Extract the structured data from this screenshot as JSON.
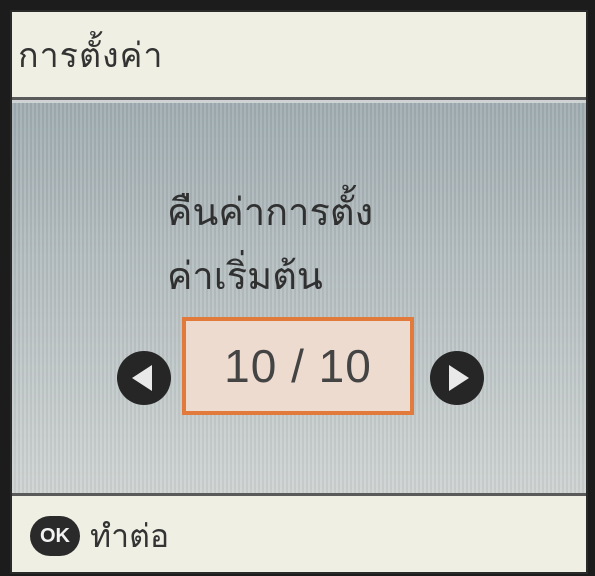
{
  "header": {
    "title": "การตั้งค่า"
  },
  "message": {
    "line1": "คืนค่าการตั้ง",
    "line2": "ค่าเริ่มต้น"
  },
  "pager": {
    "current": 10,
    "total": 10,
    "display": "10 / 10"
  },
  "footer": {
    "ok_icon": "OK",
    "action_label": "ทำต่อ"
  },
  "colors": {
    "accent": "#e27a3b",
    "counter_bg": "#eedbd0",
    "bar_bg": "#efefe3",
    "screen_bg": "#cfd3d3"
  },
  "icons": {
    "prev": "arrow-left-icon",
    "next": "arrow-right-icon",
    "ok": "ok-button-icon"
  }
}
